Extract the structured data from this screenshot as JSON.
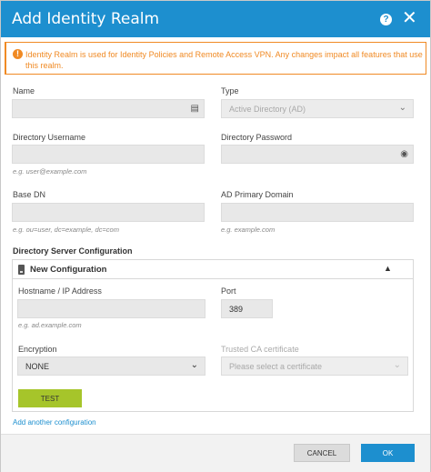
{
  "dialog": {
    "title": "Add Identity Realm",
    "help_glyph": "?",
    "close_glyph": "✕"
  },
  "alert": {
    "text": "Identity Realm is used for Identity Policies and Remote Access VPN. Any changes impact all features that use this realm."
  },
  "form": {
    "name": {
      "label": "Name",
      "value": ""
    },
    "type": {
      "label": "Type",
      "value": "Active Directory (AD)"
    },
    "username": {
      "label": "Directory Username",
      "hint": "e.g. user@example.com",
      "value": ""
    },
    "password": {
      "label": "Directory Password",
      "value": ""
    },
    "base_dn": {
      "label": "Base DN",
      "hint": "e.g. ou=user, dc=example, dc=com",
      "value": ""
    },
    "ad_domain": {
      "label": "AD Primary Domain",
      "hint": "e.g. example.com",
      "value": ""
    }
  },
  "server_config": {
    "section_title": "Directory Server Configuration",
    "config_title": "New Configuration",
    "hostname": {
      "label": "Hostname / IP Address",
      "hint": "e.g. ad.example.com",
      "value": ""
    },
    "port": {
      "label": "Port",
      "value": "389"
    },
    "encryption": {
      "label": "Encryption",
      "value": "NONE"
    },
    "ca_cert": {
      "label": "Trusted CA certificate",
      "placeholder": "Please select a certificate"
    },
    "test_label": "TEST",
    "add_another_label": "Add another configuration"
  },
  "footer": {
    "cancel_label": "CANCEL",
    "ok_label": "OK"
  },
  "colors": {
    "header": "#1d8fcf",
    "alert": "#f08a24",
    "test_button": "#a6c52a",
    "ok_button": "#1d8fcf"
  }
}
